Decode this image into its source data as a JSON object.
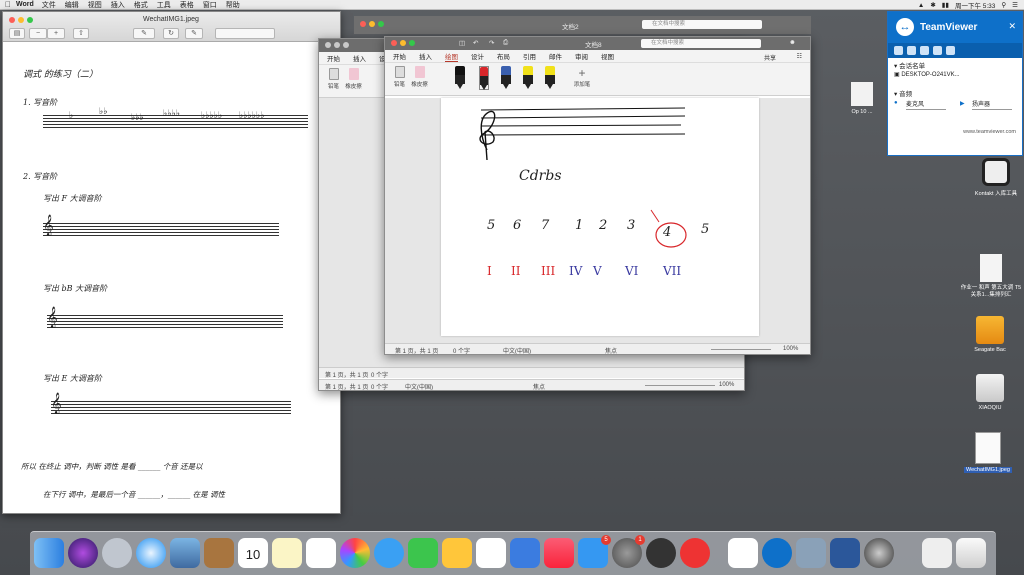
{
  "menubar": {
    "app": "Word",
    "items": [
      "文件",
      "编辑",
      "视图",
      "插入",
      "格式",
      "工具",
      "表格",
      "窗口",
      "帮助"
    ],
    "clock": "周一下午 5:33"
  },
  "preview": {
    "title": "WechatIMG1.jpeg",
    "heading": "调式 的练习（二）",
    "q1": "1. 写音阶",
    "q2": "2. 写音阶",
    "q2a": "写出 F 大调音阶",
    "q2b": "写出 bB 大调音阶",
    "q2c": "写出 E 大调音阶",
    "footer1": "所以 在终止 调中，判断 调性 是看 ______ 个音 还是以",
    "footer2": "在下行 调中，是最后一个音 ______，______ 在是 调性"
  },
  "word_back": {
    "tabs": [
      "开始",
      "插入",
      "设"
    ],
    "tool_labels": [
      "铅笔",
      "橡皮擦"
    ],
    "status": "第 1 页，共 1 页",
    "status_words": "0 个字",
    "status_lang": "中文(中国)",
    "status_focus": "焦点",
    "zoom": "100%"
  },
  "word_front": {
    "title": "文档8",
    "title_back": "文档2",
    "search_placeholder": "在文档中搜索",
    "share": "共享",
    "tabs": [
      "开始",
      "插入",
      "绘图",
      "设计",
      "布局",
      "引用",
      "邮件",
      "审阅",
      "视图"
    ],
    "active_tab": "绘图",
    "tool_labels": [
      "铅笔",
      "橡皮擦",
      "添加笔"
    ],
    "pen_colors": [
      "#111111",
      "#d8262a",
      "#3a5fae",
      "#f1e11a",
      "#f1e11a"
    ],
    "page_text": {
      "word": "Cdrbs",
      "numbers": [
        "5",
        "6",
        "7",
        "1",
        "2",
        "3",
        "4",
        "5"
      ],
      "romans": [
        "I",
        "II",
        "III",
        "IV",
        "V",
        "VI",
        "VII"
      ]
    },
    "status": "第 1 页，共 1 页",
    "status_words": "0 个字",
    "status_lang": "中文(中国)",
    "status_focus": "焦点",
    "zoom": "100%"
  },
  "teamviewer": {
    "name": "TeamViewer",
    "session_label": "会话名单",
    "device": "DESKTOP-O241VK...",
    "audio_label": "音频",
    "mic_label": "麦克风",
    "speaker_label": "扬声器",
    "url": "www.teamviewer.com"
  },
  "desktop_icons": [
    {
      "label": "Op 10 ..."
    },
    {
      "label": "Kontakt 入库工具"
    },
    {
      "label": "作业一 和声 第五大调 T5 关系1...集排列汇"
    },
    {
      "label": "Seagate Bac"
    },
    {
      "label": "XIAOQIU"
    },
    {
      "label": "WechatIMG1.jpeg"
    }
  ],
  "dock": {
    "calendar_day": "10",
    "app_store_badge": "5",
    "prefs_badge": "1"
  }
}
